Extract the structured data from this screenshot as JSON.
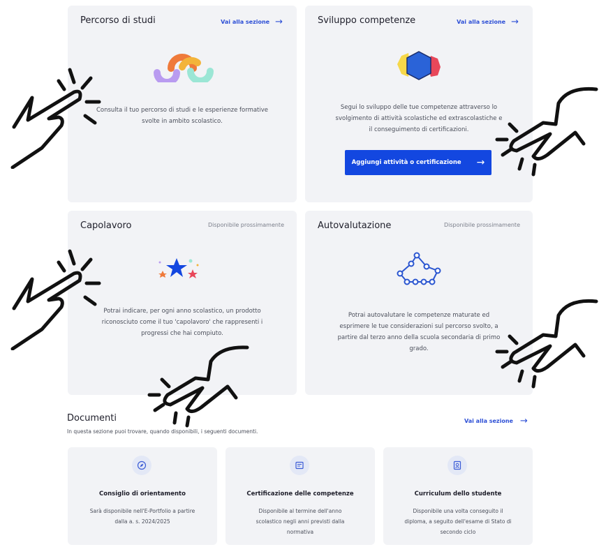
{
  "cards": {
    "percorso": {
      "title": "Percorso di studi",
      "link": "Vai alla sezione",
      "description": "Consulta il tuo percorso di studi e le esperienze formative svolte in ambito scolastico."
    },
    "sviluppo": {
      "title": "Sviluppo competenze",
      "link": "Vai alla sezione",
      "description": "Segui lo sviluppo delle tue competenze attraverso lo svolgimento di attività scolastiche ed extrascolastiche e il conseguimento di certificazioni.",
      "button": "Aggiungi attività o certificazione"
    },
    "capolavoro": {
      "title": "Capolavoro",
      "status": "Disponibile prossimamente",
      "description": "Potrai indicare, per ogni anno scolastico, un prodotto riconosciuto come il tuo 'capolavoro' che rappresenti i progressi che hai compiuto."
    },
    "autovalutazione": {
      "title": "Autovalutazione",
      "status": "Disponibile prossimamente",
      "description": "Potrai autovalutare le competenze maturate ed esprimere le tue considerazioni sul percorso svolto, a partire dal terzo anno della scuola secondaria di primo grado."
    }
  },
  "documents": {
    "title": "Documenti",
    "subtitle": "In questa sezione puoi trovare, quando disponibili, i seguenti documenti.",
    "link": "Vai alla sezione",
    "items": [
      {
        "title": "Consiglio di orientamento",
        "description": "Sarà disponibile nell'E-Portfolio a partire dalla a. s. 2024/2025",
        "icon": "compass-icon"
      },
      {
        "title": "Certificazione delle competenze",
        "description": "Disponibile al termine dell'anno scolastico negli anni previsti dalla normativa",
        "icon": "certificate-icon"
      },
      {
        "title": "Curriculum dello studente",
        "description": "Disponibile una volta conseguito il diploma, a seguito dell'esame di Stato di secondo ciclo",
        "icon": "curriculum-icon"
      }
    ]
  },
  "colors": {
    "accent": "#1347e0",
    "link": "#2d4fd6",
    "card_bg": "#f2f3f6"
  }
}
